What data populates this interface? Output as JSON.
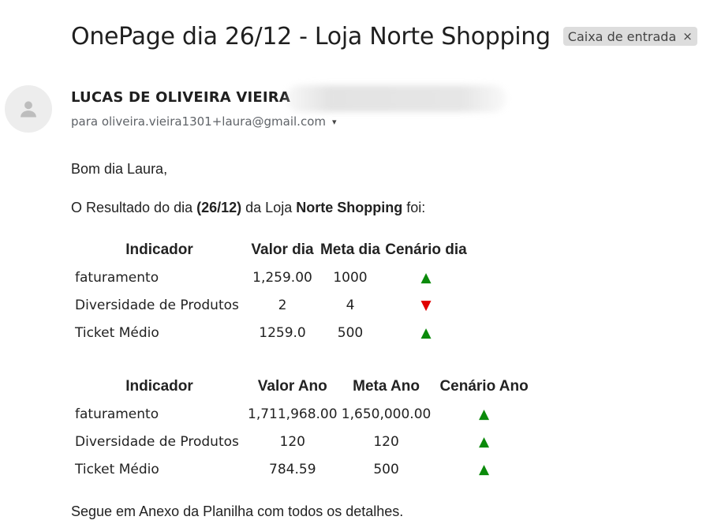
{
  "email": {
    "subject": "OnePage dia 26/12 - Loja Norte Shopping",
    "label": "Caixa de entrada",
    "label_close": "×",
    "sender_name": "LUCAS DE OLIVEIRA VIEIRA",
    "recipient": "para oliveira.vieira1301+laura@gmail.com",
    "recipient_caret": "▾",
    "greeting": "Bom dia Laura,",
    "intro": {
      "prefix": "O Resultado do dia ",
      "date": "(26/12)",
      "middle": " da Loja ",
      "store": "Norte Shopping",
      "suffix": " foi:"
    },
    "footer": "Segue em Anexo da Planilha com todos os detalhes."
  },
  "daily_table": {
    "headers": [
      "Indicador",
      "Valor dia",
      "Meta dia",
      "Cenário dia"
    ],
    "rows": [
      {
        "name": "faturamento",
        "value": "1,259.00",
        "target": "1000",
        "trend": "▲",
        "trend_dir": "up"
      },
      {
        "name": "Diversidade de Produtos",
        "value": "2",
        "target": "4",
        "trend": "▼",
        "trend_dir": "down"
      },
      {
        "name": "Ticket Médio",
        "value": "1259.0",
        "target": "500",
        "trend": "▲",
        "trend_dir": "up"
      }
    ]
  },
  "yearly_table": {
    "headers": [
      "Indicador",
      "Valor Ano",
      "Meta Ano",
      "Cenário Ano"
    ],
    "rows": [
      {
        "name": "faturamento",
        "value": "1,711,968.00",
        "target": "1,650,000.00",
        "trend": "▲",
        "trend_dir": "up"
      },
      {
        "name": "Diversidade de Produtos",
        "value": "120",
        "target": "120",
        "trend": "▲",
        "trend_dir": "up"
      },
      {
        "name": "Ticket Médio",
        "value": "784.59",
        "target": "500",
        "trend": "▲",
        "trend_dir": "up"
      }
    ]
  },
  "colors": {
    "trend_up": "#0b8a0b",
    "trend_down": "#e00000",
    "label_chip_bg": "#dddddd"
  },
  "icons": {
    "avatar": "person-icon",
    "label_remove": "close-icon",
    "recipient_details": "chevron-down-icon"
  }
}
